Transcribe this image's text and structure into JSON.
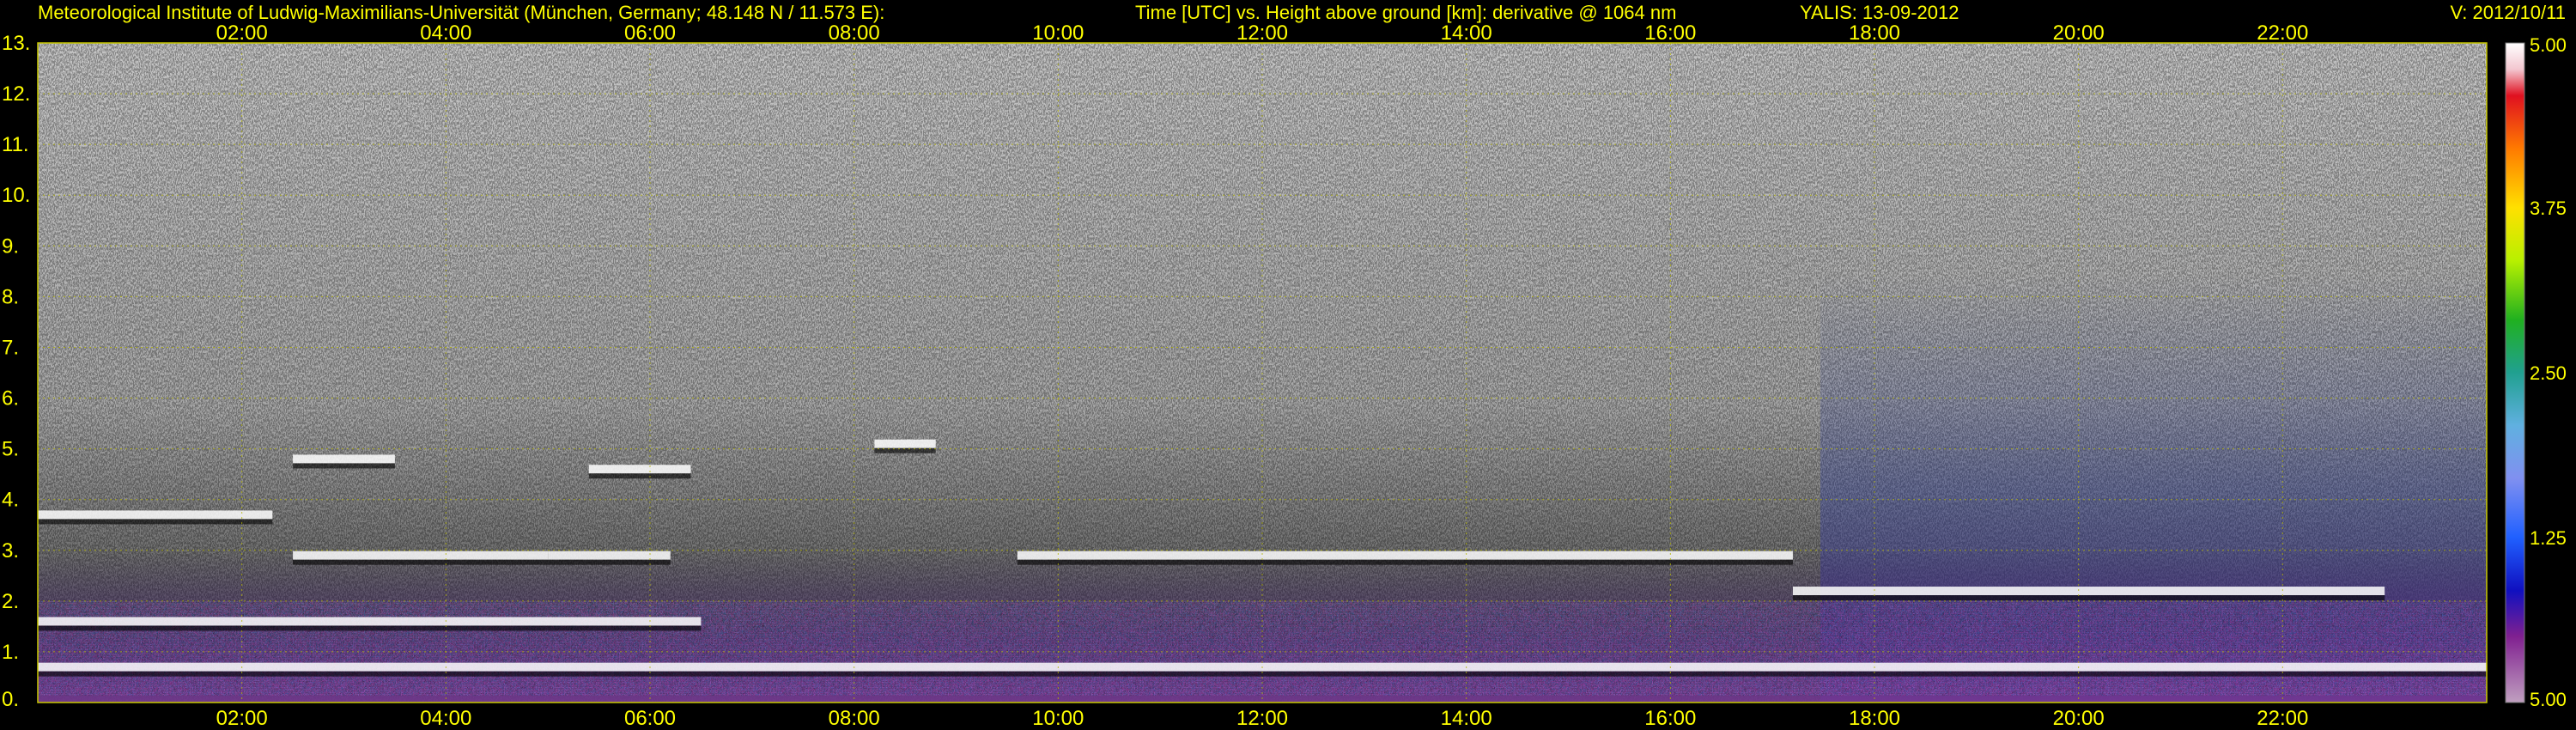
{
  "header": {
    "institute": "Meteorological Institute of Ludwig-Maximilians-Universität (München, Germany; 48.148 N / 11.573 E):",
    "axes_title": "Time [UTC] vs. Height above ground [km]: derivative @ 1064 nm",
    "instrument": "YALIS: 13-09-2012",
    "version": "V: 2012/10/11"
  },
  "chart_data": {
    "type": "heatmap",
    "title": "Time [UTC] vs. Height above ground [km]: derivative @ 1064 nm",
    "x_ticks": [
      "02:00",
      "04:00",
      "06:00",
      "08:00",
      "10:00",
      "12:00",
      "14:00",
      "16:00",
      "18:00",
      "20:00",
      "22:00"
    ],
    "x_tick_hours": [
      2,
      4,
      6,
      8,
      10,
      12,
      14,
      16,
      18,
      20,
      22
    ],
    "xlim_hours": [
      0,
      24
    ],
    "y_ticks": [
      "1.",
      "2.",
      "3.",
      "4.",
      "5.",
      "6.",
      "7.",
      "8.",
      "9.",
      "10.",
      "11.",
      "12.",
      "13."
    ],
    "y_tick_values": [
      1,
      2,
      3,
      4,
      5,
      6,
      7,
      8,
      9,
      10,
      11,
      12,
      13
    ],
    "y_zero_label": "0.",
    "ylim_km": [
      0,
      13
    ],
    "grid": true,
    "colorbar": {
      "labels": [
        "5.00",
        "3.75",
        "2.50",
        "1.25",
        "5.00"
      ],
      "label_fractions": [
        0,
        0.25,
        0.5,
        0.75,
        1
      ]
    },
    "layers": [
      {
        "t0": 0.0,
        "t1": 2.3,
        "h": 3.7
      },
      {
        "t0": 2.5,
        "t1": 3.5,
        "h": 4.8
      },
      {
        "t0": 2.5,
        "t1": 5.0,
        "h": 2.9
      },
      {
        "t0": 5.4,
        "t1": 6.4,
        "h": 4.6
      },
      {
        "t0": 5.0,
        "t1": 6.2,
        "h": 2.9
      },
      {
        "t0": 8.2,
        "t1": 8.8,
        "h": 5.1
      },
      {
        "t0": 9.6,
        "t1": 17.2,
        "h": 2.9
      },
      {
        "t0": 17.2,
        "t1": 23.0,
        "h": 2.2
      },
      {
        "t0": 0.0,
        "t1": 6.5,
        "h": 1.6
      },
      {
        "t0": 0.0,
        "t1": 24.0,
        "h": 0.7
      }
    ],
    "colors": {
      "axis_text": "#ffff00",
      "grid": "#b5b500",
      "background": "#000000"
    }
  }
}
